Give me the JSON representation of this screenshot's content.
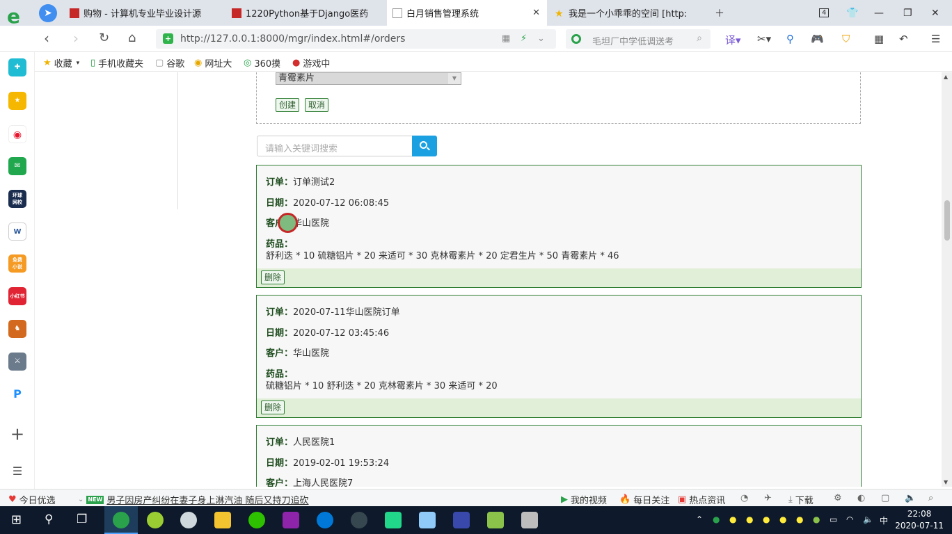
{
  "browser": {
    "tabs": [
      {
        "label": "购物 - 计算机专业毕业设计源",
        "active": false
      },
      {
        "label": "1220Python基于Django医药",
        "active": false
      },
      {
        "label": "白月销售管理系统",
        "active": true
      },
      {
        "label": "我是一个小乖乖的空间 [http:",
        "active": false
      }
    ],
    "tab_count_badge": "4",
    "url": "http://127.0.0.1:8000/mgr/index.html#/orders",
    "search_placeholder": "毛坦厂中学低调送考",
    "bookmarks": [
      "收藏",
      "手机收藏夹",
      "谷歌",
      "网址大",
      "360摸",
      "游戏中"
    ]
  },
  "page": {
    "form": {
      "medicine_select": "青霉素片",
      "create_button": "创建",
      "cancel_button": "取消"
    },
    "search": {
      "placeholder": "请输入关键词搜索"
    },
    "labels": {
      "order": "订单：",
      "date": "日期：",
      "customer": "客户：",
      "medicines": "药品："
    },
    "delete_button": "删除",
    "orders": [
      {
        "name": "订单测试2",
        "date": "2020-07-12 06:08:45",
        "customer": "华山医院",
        "medicines": "舒利迭 * 10 硫糖铝片 * 20 来适可 * 30 克林霉素片 * 20 定君生片 * 50 青霉素片 * 46"
      },
      {
        "name": "2020-07-11华山医院订单",
        "date": "2020-07-12 03:45:46",
        "customer": "华山医院",
        "medicines": "硫糖铝片 * 10 舒利迭 * 20 克林霉素片 * 30 来适可 * 20"
      },
      {
        "name": "人民医院1",
        "date": "2019-02-01 19:53:24",
        "customer": "上海人民医院7"
      }
    ]
  },
  "statusbar": {
    "today": "今日优选",
    "news": "男子因房产纠纷在妻子身上淋汽油 随后又持刀追砍",
    "my_video": "我的视频",
    "daily_focus": "每日关注",
    "hot_news": "热点资讯",
    "download": "下载"
  },
  "taskbar": {
    "ime": "中",
    "time": "22:08",
    "date": "2020-07-11"
  },
  "colors": {
    "order_border": "#2e7d32",
    "order_footer": "#e1efd9",
    "search_button": "#1ba1e2"
  }
}
